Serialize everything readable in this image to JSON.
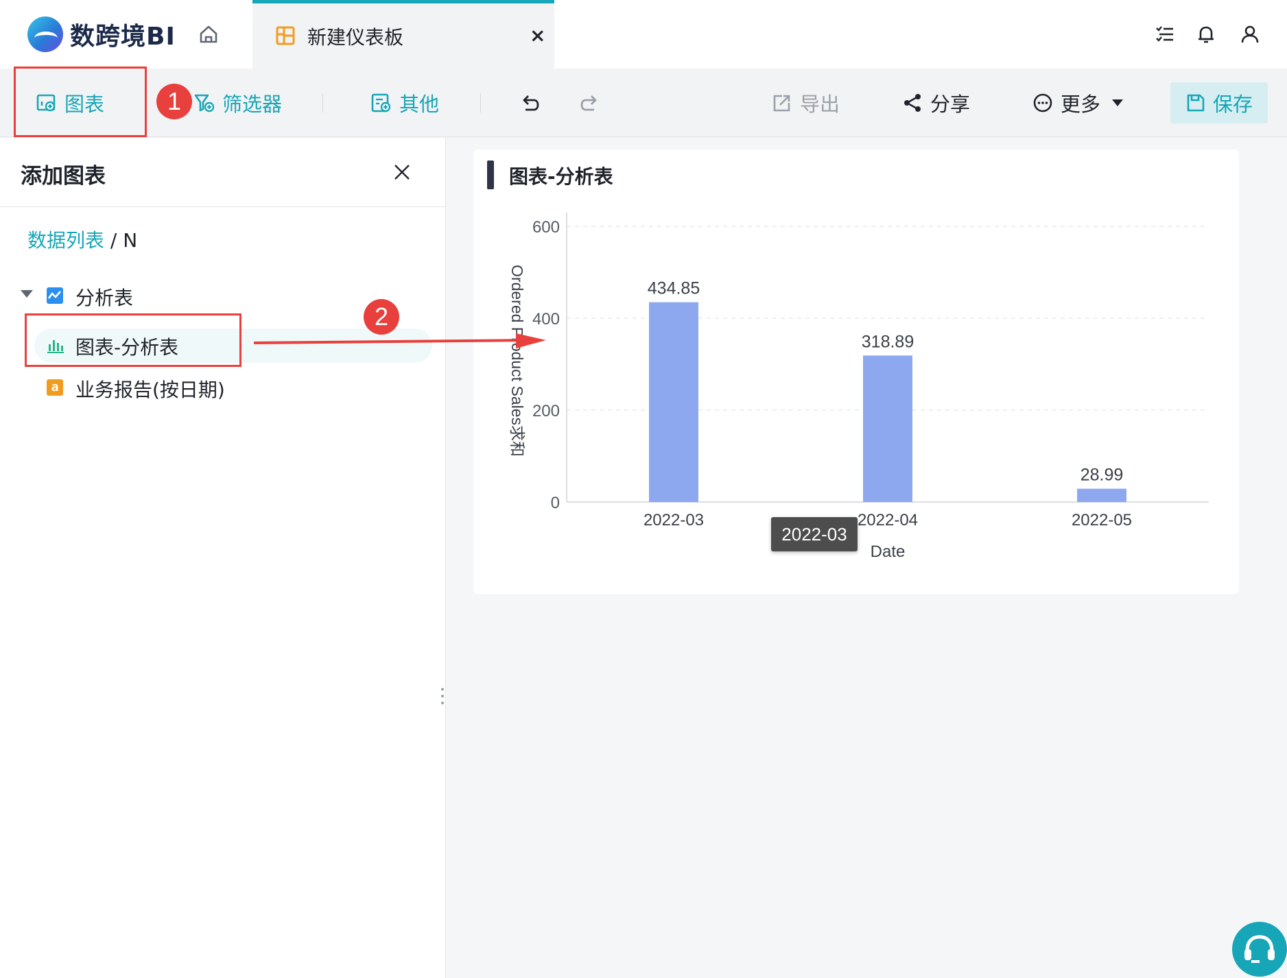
{
  "app": {
    "logo_text": "数跨境BI"
  },
  "tab": {
    "label": "新建仪表板",
    "close": "×"
  },
  "toolbar": {
    "chart": "图表",
    "filter": "筛选器",
    "other": "其他",
    "export": "导出",
    "share": "分享",
    "more": "更多",
    "save": "保存"
  },
  "panel": {
    "title": "添加图表",
    "breadcrumb_link": "数据列表",
    "breadcrumb_sep": " / ",
    "breadcrumb_current": "N",
    "group": "分析表",
    "items": [
      {
        "label": "图表-分析表",
        "icon": "bar-chart-icon"
      },
      {
        "label": "业务报告(按日期)",
        "icon": "amazon-icon"
      }
    ]
  },
  "annotations": {
    "step1": "1",
    "step2": "2"
  },
  "tooltip": {
    "text": "2022-03"
  },
  "colors": {
    "accent": "#17a6b7",
    "bar": "#8ea8f0",
    "annotation": "#e8403c"
  },
  "chart_data": {
    "type": "bar",
    "title": "图表-分析表",
    "categories": [
      "2022-03",
      "2022-04",
      "2022-05"
    ],
    "values": [
      434.85,
      318.89,
      28.99
    ],
    "data_labels": [
      "434.85",
      "318.89",
      "28.99"
    ],
    "xlabel": "Date",
    "ylabel": "Ordered Product Sales求和",
    "ylim": [
      0,
      600
    ],
    "yticks": [
      0,
      200,
      400,
      600
    ],
    "grid": true
  }
}
